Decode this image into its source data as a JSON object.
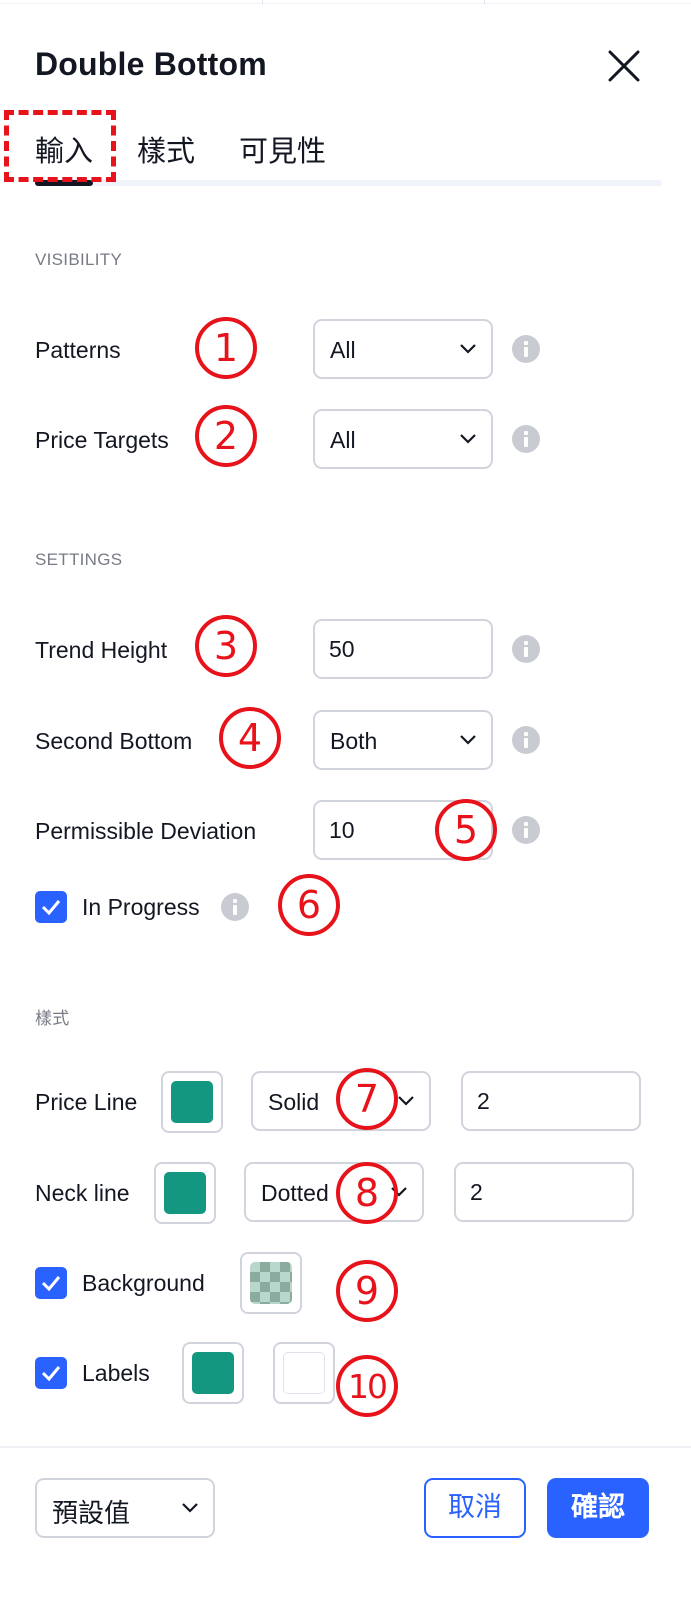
{
  "dialog": {
    "title": "Double Bottom"
  },
  "tabs": [
    {
      "label": "輸入",
      "active": true
    },
    {
      "label": "樣式",
      "active": false
    },
    {
      "label": "可見性",
      "active": false
    }
  ],
  "visibility": {
    "heading": "VISIBILITY",
    "patterns": {
      "label": "Patterns",
      "value": "All"
    },
    "price_targets": {
      "label": "Price Targets",
      "value": "All"
    }
  },
  "settings": {
    "heading": "SETTINGS",
    "trend_height": {
      "label": "Trend Height",
      "value": "50"
    },
    "second_bottom": {
      "label": "Second Bottom",
      "value": "Both"
    },
    "permissible_deviation": {
      "label": "Permissible Deviation",
      "value": "10"
    },
    "in_progress": {
      "label": "In Progress",
      "checked": true
    }
  },
  "style": {
    "heading": "樣式",
    "price_line": {
      "label": "Price Line",
      "color": "#139780",
      "line_style": "Solid",
      "width": "2"
    },
    "neck_line": {
      "label": "Neck line",
      "color": "#139780",
      "line_style": "Dotted",
      "width": "2"
    },
    "background": {
      "label": "Background",
      "checked": true,
      "color": "checkered-teal"
    },
    "labels": {
      "label": "Labels",
      "checked": true,
      "color": "#139780",
      "text_color": "#ffffff"
    }
  },
  "annotations": [
    "1",
    "2",
    "3",
    "4",
    "5",
    "6",
    "7",
    "8",
    "9",
    "10"
  ],
  "footer": {
    "defaults_label": "預設值",
    "cancel_label": "取消",
    "confirm_label": "確認"
  },
  "colors": {
    "accent": "#2962ff",
    "annotation": "#e8121b",
    "teal": "#139780"
  }
}
